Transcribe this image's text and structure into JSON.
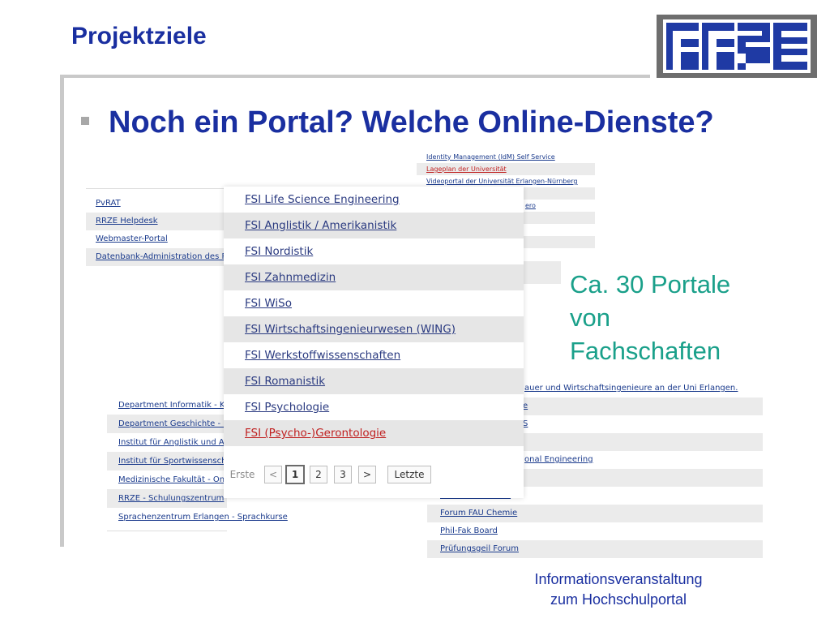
{
  "slide": {
    "title": "Projektziele",
    "heading": "Noch ein Portal? Welche Online-Dienste?",
    "callout": "Ca. 30 Portale\nvon\nFachschaften",
    "footer": "Informationsveranstaltung\nzum Hochschulportal"
  },
  "panel_top_right": {
    "items": [
      "Identity Management (IdM) Self Service",
      "Lageplan der Universität",
      "Videoportal der Universität Erlangen-Nürnberg",
      "",
      "ero",
      "",
      "",
      ""
    ]
  },
  "panel_top_left": {
    "items": [
      "PvRAT",
      "RRZE Helpdesk",
      "Webmaster-Portal",
      "Datenbank-Administration des RR"
    ]
  },
  "panel_fsi": {
    "items": [
      "FSI Life Science Engineering",
      "FSI Anglistik / Amerikanistik",
      "FSI Nordistik",
      "FSI Zahnmedizin",
      "FSI WiSo",
      "FSI Wirtschaftsingenieurwesen (WING)",
      "FSI Werkstoffwissenschaften",
      "FSI Romanistik",
      "FSI Psychologie",
      "FSI (Psycho-)Gerontologie"
    ],
    "pager": {
      "first": "Erste",
      "prev": "<",
      "pages": [
        "1",
        "2",
        "3"
      ],
      "next": ">",
      "last": "Letzte"
    }
  },
  "panel_lower_left": {
    "items": [
      "Department Informatik - K",
      "Department Geschichte - K",
      "Institut für Anglistik und A",
      "Institut für Sportwissensch",
      "Medizinische Fakultät - On",
      "RRZE - Schulungszentrum",
      "Sprachenzentrum Erlangen - Sprachkurse"
    ]
  },
  "panel_lower_right": {
    "items": [
      "auer und Wirtschaftsingenieure an der Uni Erlangen.",
      "e",
      "S",
      "",
      "onal Engineering",
      "",
      "Forum FSI Kanule",
      "Forum FAU Chemie",
      "Phil-Fak Board",
      "Prüfungsgeil Forum"
    ]
  },
  "colors": {
    "title": "#1a2fa0",
    "callout": "#1aa08a",
    "logo_blue": "#1f3aa4",
    "highlight_red": "#c02020"
  }
}
